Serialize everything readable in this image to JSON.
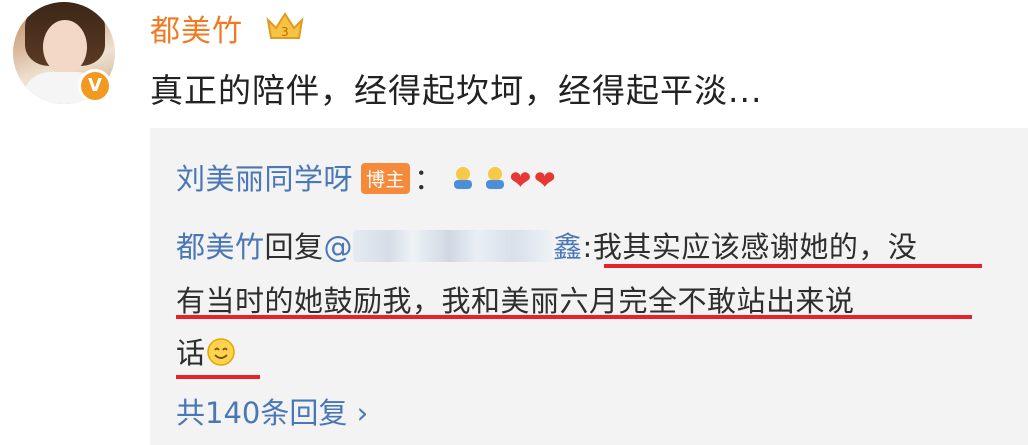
{
  "post": {
    "username": "都美竹",
    "verified_badge": "V",
    "crown_icon": "crown-icon",
    "text": "真正的陪伴，经得起坎坷，经得起平淡..."
  },
  "quote": {
    "author": "刘美丽同学呀",
    "author_tag": "博主",
    "colon": "：",
    "reply_prefix": "都美竹",
    "reply_word": "回复",
    "mention_start": "@",
    "mention_end": "鑫",
    "line1_rest": ":我其实应该感谢她的，没",
    "line2": "有当时的她鼓励我，我和美丽六月完全不敢站出来说",
    "line3": "话",
    "more_replies": "共140条回复 ",
    "chevron": "›"
  },
  "colors": {
    "accent_orange": "#f07a24",
    "link_blue": "#4a77b5",
    "underline_red": "#e3242b"
  }
}
